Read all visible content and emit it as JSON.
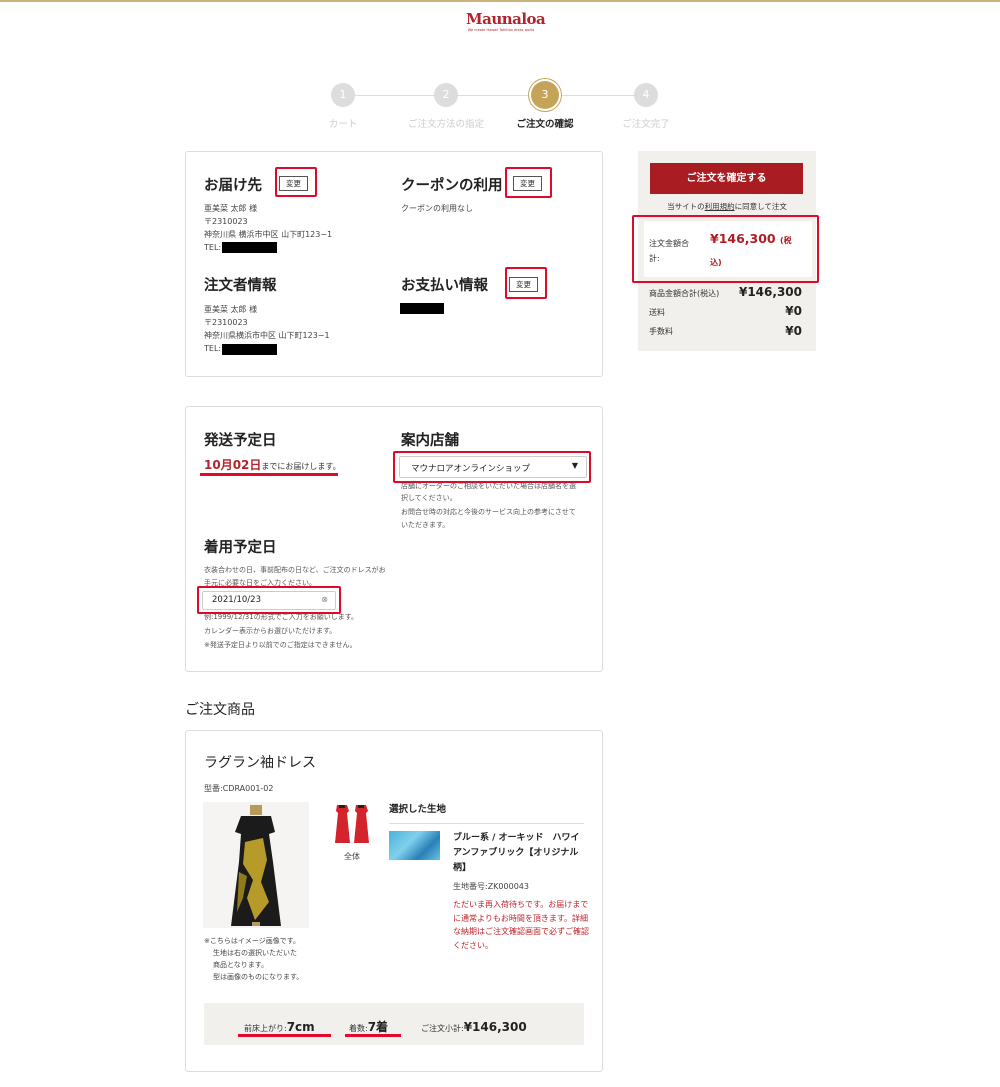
{
  "brand": {
    "name": "Maunaloa",
    "tagline": "We create Hawaii Tahitian dress world"
  },
  "steps": [
    {
      "num": "1",
      "label": "カート"
    },
    {
      "num": "2",
      "label": "ご注文方法の指定"
    },
    {
      "num": "3",
      "label": "ご注文の確認"
    },
    {
      "num": "4",
      "label": "ご注文完了"
    }
  ],
  "delivery": {
    "title": "お届け先",
    "change": "変更",
    "name": "亜美菜 太郎 様",
    "zip": "〒2310023",
    "address": "神奈川県 横浜市中区 山下町123−1",
    "tel_label": "TEL:"
  },
  "coupon": {
    "title": "クーポンの利用",
    "change": "変更",
    "text": "クーポンの利用なし"
  },
  "orderer": {
    "title": "注文者情報",
    "name": "亜美菜 太郎 様",
    "zip": "〒2310023",
    "address": "神奈川県横浜市中区 山下町123−1",
    "tel_label": "TEL:"
  },
  "payment": {
    "title": "お支払い情報",
    "change": "変更"
  },
  "shipping": {
    "title": "発送予定日",
    "date": "10月02日",
    "suffix": "までにお届けします。"
  },
  "store": {
    "title": "案内店舗",
    "selected": "マウナロアオンラインショップ",
    "note1": "店舗にオーダーのご相談をいただいた場合は店舗名を選",
    "note2": "択してください。",
    "note3": "お問合せ時の対応と今後のサービス向上の参考にさせて",
    "note4": "いただきます。"
  },
  "wear": {
    "title": "着用予定日",
    "note1": "衣装合わせの日、事前配布の日など、ご注文のドレスがお",
    "note2": "手元に必要な日をご入力ください。",
    "value": "2021/10/23",
    "hint1": "例:1999/12/31の形式でご入力をお願いします。",
    "hint2": "カレンダー表示からお選びいただけます。",
    "hint3": "※発送予定日より以前でのご指定はできません。"
  },
  "products_heading": "ご注文商品",
  "product": {
    "name": "ラグラン袖ドレス",
    "model": "型番:CDRA001-02",
    "image_note1": "※こちらはイメージ画像です。",
    "image_note2": "生地は右の選択いただいた",
    "image_note3": "商品となります。",
    "image_note4": "型は画像のものになります。",
    "variant_label": "全体",
    "fabric_heading": "選択した生地",
    "fabric_name": "ブルー系 / オーキッド　ハワイアンファブリック【オリジナル柄】",
    "fabric_no": "生地番号:ZK000043",
    "stock_note": "ただいま再入荷待ちです。お届けまでに通常よりもお時間を頂きます。詳細な納期はご注文確認画面で必ずご確認ください。",
    "length_label": "前床上がり:",
    "length_value": "7cm",
    "qty_label": "着数:",
    "qty_value": "7着",
    "subtotal_label": "ご注文小計:",
    "subtotal_value": "¥146,300"
  },
  "summary": {
    "confirm_button": "ご注文を確定する",
    "agree_prefix": "当サイトの",
    "agree_link": "利用規約",
    "agree_suffix": "に同意して注文",
    "total_label_1": "注文金額合",
    "total_label_2": "計:",
    "total_value": "¥146,300",
    "tax_1": "(税",
    "tax_2": "込)",
    "items_label": "商品金額合計(税込)",
    "items_value": "¥146,300",
    "shipping_label": "送料",
    "shipping_value": "¥0",
    "fee_label": "手数料",
    "fee_value": "¥0"
  },
  "colors": {
    "accent": "#a91d22",
    "highlight": "#e0092a",
    "gold": "#c5a45a"
  }
}
